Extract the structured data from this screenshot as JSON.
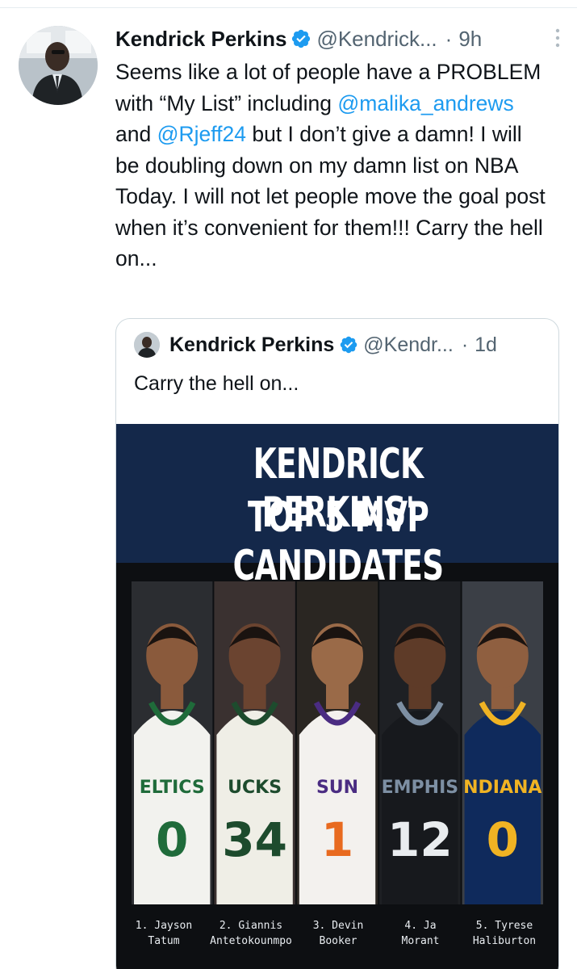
{
  "tweet": {
    "display_name": "Kendrick Perkins",
    "handle": "@Kendrick...",
    "dot": "·",
    "time": "9h",
    "text_parts": {
      "p1": "Seems like a lot of people have a PROBLEM with “My List” including ",
      "mention1": "@malika_andrews",
      "p2": " and ",
      "mention2": "@Rjeff24",
      "p3": " but I don’t give a damn! I will be doubling down on my damn list on NBA Today. I will not let people move the goal post when it’s convenient for them!!! Carry the hell on..."
    }
  },
  "quote": {
    "display_name": "Kendrick Perkins",
    "handle": "@Kendr...",
    "dot": "·",
    "time": "1d",
    "text": "Carry the hell on...",
    "media": {
      "title_line1": "KENDRICK PERKINS'",
      "title_line2": "TOP 5 MVP CANDIDATES",
      "players": [
        {
          "line1": "1. Jayson",
          "line2": "Tatum",
          "jersey_text": "ELTICS",
          "number": "0",
          "jersey_color": "#f2f2ee",
          "trim_color": "#1f6b3a",
          "num_color": "#1f6b3a"
        },
        {
          "line1": "2. Giannis",
          "line2": "Antetokounmpo",
          "jersey_text": "UCKS",
          "number": "34",
          "jersey_color": "#efeee6",
          "trim_color": "#1d4b2d",
          "num_color": "#1d4b2d"
        },
        {
          "line1": "3. Devin",
          "line2": "Booker",
          "jersey_text": "SUN",
          "number": "1",
          "jersey_color": "#f3f1ee",
          "trim_color": "#4a2c82",
          "num_color": "#e86a1f"
        },
        {
          "line1": "4. Ja",
          "line2": "Morant",
          "jersey_text": "EMPHIS",
          "number": "12",
          "jersey_color": "#17191d",
          "trim_color": "#7d8fa3",
          "num_color": "#e9ecef"
        },
        {
          "line1": "5. Tyrese",
          "line2": "Haliburton",
          "jersey_text": "NDIANA",
          "number": "0",
          "jersey_color": "#0f2a5c",
          "trim_color": "#f0b323",
          "num_color": "#f0b323"
        }
      ]
    }
  },
  "colors": {
    "link": "#1d9bf0",
    "muted": "#536471",
    "banner_bg": "#14284a"
  },
  "icons": {
    "verified": "verified-badge-icon",
    "more": "more-vertical-icon"
  }
}
